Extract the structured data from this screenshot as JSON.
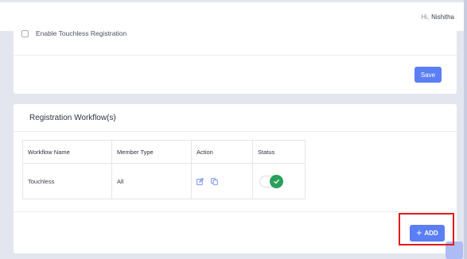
{
  "header": {
    "greeting": "Hi,",
    "user_name": "Nishitha"
  },
  "settings": {
    "touchless_checkbox_label": "Enable Touchless Registration",
    "touchless_checked": false,
    "save_label": "Save"
  },
  "workflows": {
    "title": "Registration Workflow(s)",
    "columns": [
      "Workflow Name",
      "Member Type",
      "Action",
      "Status"
    ],
    "rows": [
      {
        "name": "Touchless",
        "member_type": "All",
        "actions": [
          "edit-icon",
          "copy-icon"
        ],
        "status_enabled": true
      }
    ],
    "add_label": "ADD",
    "add_icon": "plus-icon"
  },
  "colors": {
    "primary": "#5a7ff5",
    "toggle_on": "#28a05b",
    "highlight": "#e11b1b"
  }
}
